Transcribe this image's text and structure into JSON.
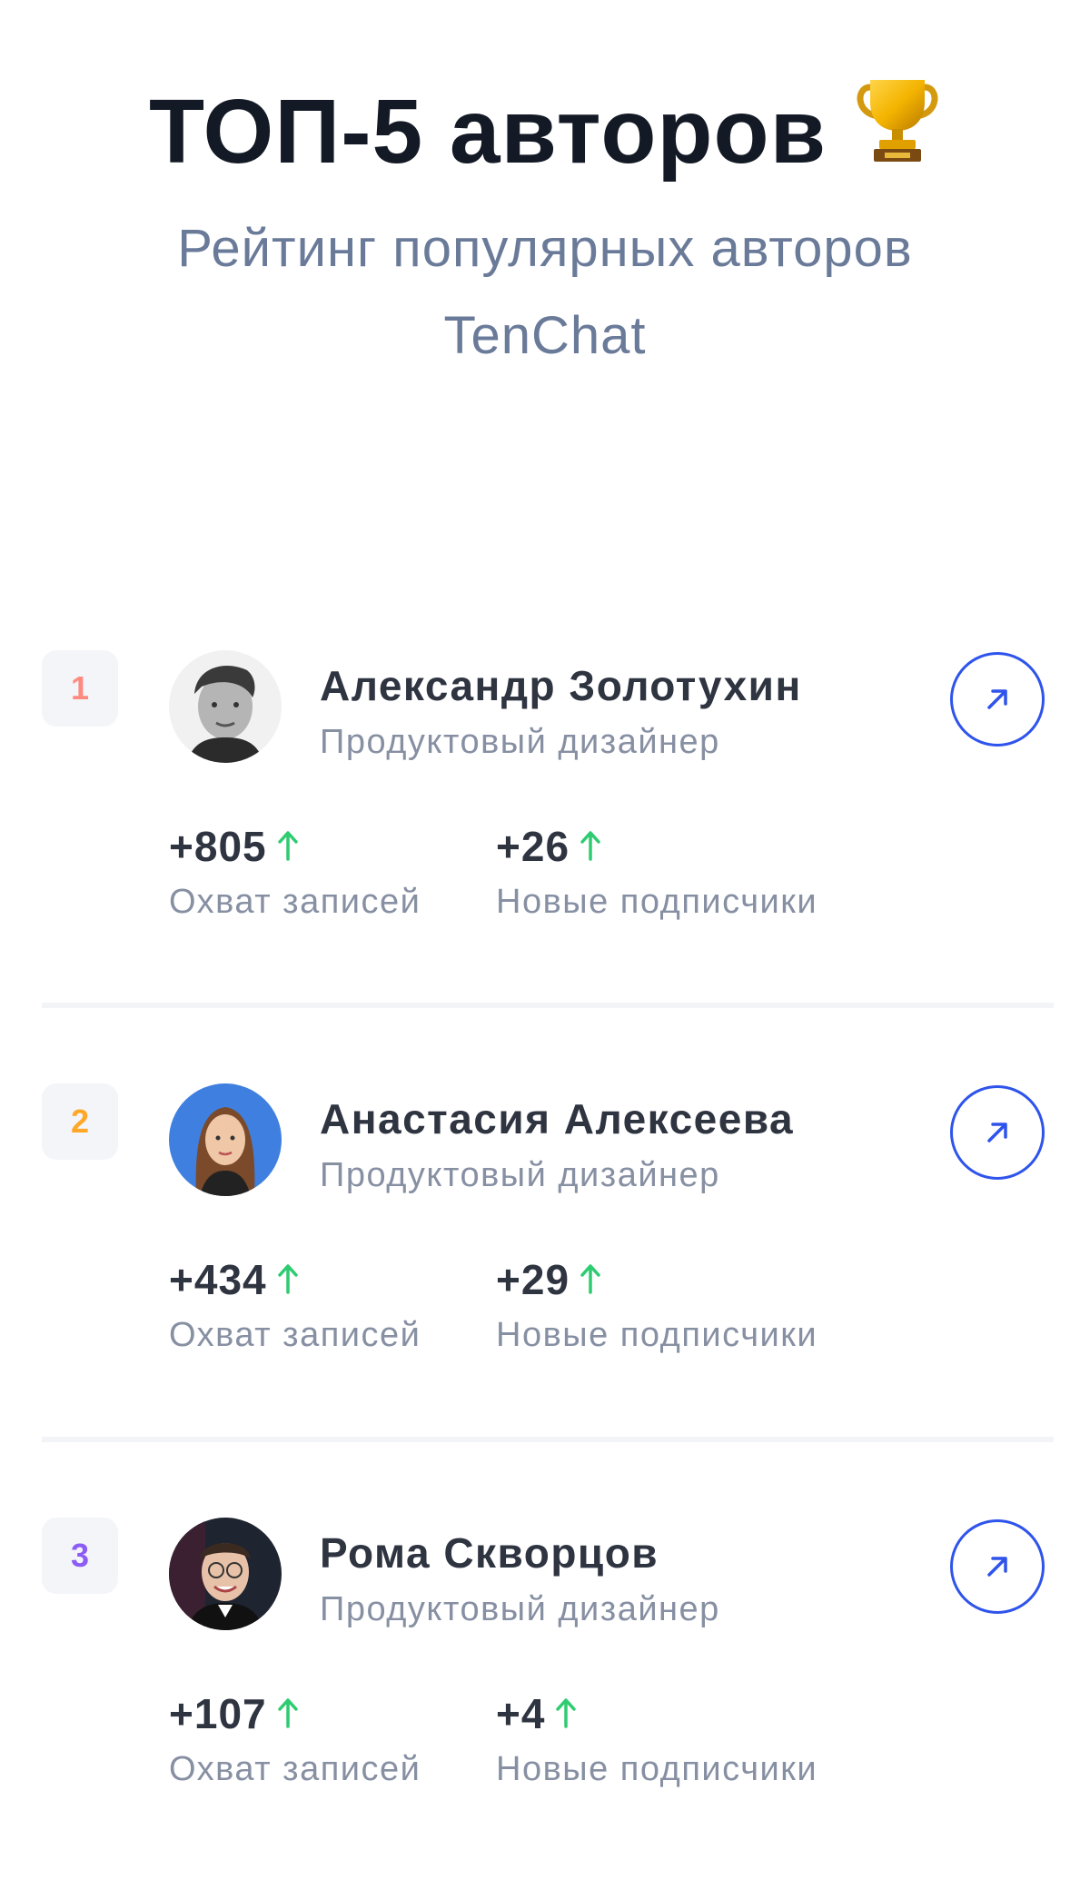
{
  "header": {
    "title": "ТОП-5 авторов",
    "trophy_icon": "trophy-icon",
    "subtitle": "Рейтинг популярных авторов TenChat"
  },
  "colors": {
    "accent": "#2f54eb",
    "up_arrow": "#2ecc71",
    "rank_1": "#ff8a80",
    "rank_2": "#ffa726",
    "rank_3": "#8b5cf6"
  },
  "authors": [
    {
      "rank": "1",
      "name": "Александр Золотухин",
      "role": "Продуктовый дизайнер",
      "reach_value": "+805",
      "reach_label": "Охват записей",
      "subs_value": "+26",
      "subs_label": "Новые подписчики"
    },
    {
      "rank": "2",
      "name": "Анастасия Алексеева",
      "role": "Продуктовый дизайнер",
      "reach_value": "+434",
      "reach_label": "Охват записей",
      "subs_value": "+29",
      "subs_label": "Новые подписчики"
    },
    {
      "rank": "3",
      "name": "Рома Скворцов",
      "role": "Продуктовый дизайнер",
      "reach_value": "+107",
      "reach_label": "Охват записей",
      "subs_value": "+4",
      "subs_label": "Новые подписчики"
    }
  ]
}
